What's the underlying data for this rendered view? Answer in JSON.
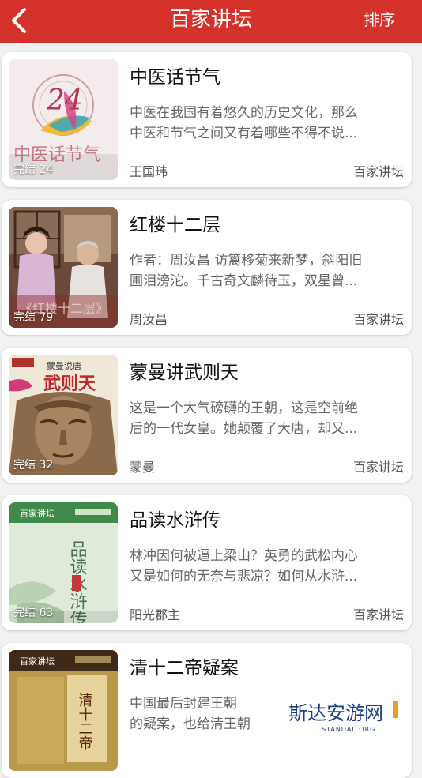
{
  "header": {
    "title": "百家讲坛",
    "sort_label": "排序",
    "back_icon": "chevron-left-icon"
  },
  "colors": {
    "header_bg": "#d6322c",
    "card_bg": "#ffffff",
    "page_bg": "#f2f2f2"
  },
  "books": [
    {
      "title": "中医话节气",
      "desc_line1": "中医在我国有着悠久的历史文化，那么",
      "desc_line2": "中医和节气之间又有着哪些不得不说...",
      "author": "王国玮",
      "category": "百家讲坛",
      "status": "完结 24",
      "cover_text": "中医话节气",
      "cover_number": "24"
    },
    {
      "title": "红楼十二层",
      "desc_line1": "作者：周汝昌 访篱移菊来新梦，斜阳旧",
      "desc_line2": "圃泪滂沱。千古奇文麟待玉，双星曾...",
      "author": "周汝昌",
      "category": "百家讲坛",
      "status": "完结 79",
      "cover_text": "《红楼十二层》"
    },
    {
      "title": "蒙曼讲武则天",
      "desc_line1": "这是一个大气磅礴的王朝，这是空前绝",
      "desc_line2": "后的一代女皇。她颠覆了大唐，却又...",
      "author": "蒙曼",
      "category": "百家讲坛",
      "status": "完结 32",
      "cover_text": "武则天",
      "cover_subtext": "蒙曼说唐"
    },
    {
      "title": "品读水浒传",
      "desc_line1": "林冲因何被逼上梁山？英勇的武松内心",
      "desc_line2": "又是如何的无奈与悲凉？如何从水浒...",
      "author": "阳光郡主",
      "category": "百家讲坛",
      "status": "完结 63",
      "cover_text": "品读水浒传",
      "cover_logo": "百家讲坛"
    },
    {
      "title": "清十二帝疑案",
      "desc_line1": "中国最后封建王朝",
      "desc_line2": "的疑案，也给清王朝",
      "cover_text": "清十二帝",
      "cover_logo": "百家讲坛"
    }
  ],
  "watermark": {
    "text": "斯达安游网",
    "subtext": "STANDAL.ORG"
  }
}
